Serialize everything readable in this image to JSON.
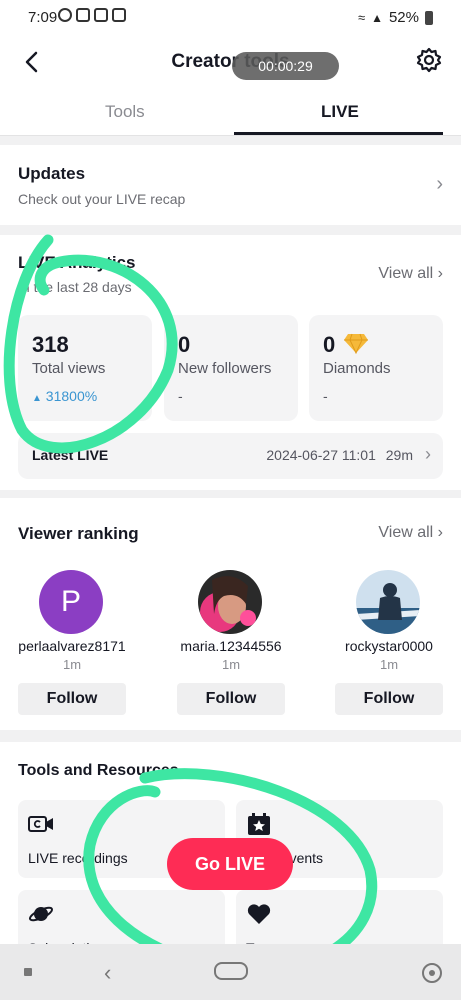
{
  "status_bar": {
    "time": "7:09",
    "battery": "52%"
  },
  "header": {
    "title": "Creator tools",
    "recording_timer": "00:00:29"
  },
  "tabs": [
    {
      "label": "Tools"
    },
    {
      "label": "LIVE",
      "active": true
    }
  ],
  "updates": {
    "title": "Updates",
    "subtitle": "Check out your LIVE recap"
  },
  "analytics": {
    "title": "LIVE Analytics",
    "subtitle": "In the last 28 days",
    "view_all": "View all",
    "stats": [
      {
        "value": "318",
        "label": "Total views",
        "change": "31800%"
      },
      {
        "value": "0",
        "label": "New followers",
        "change": "-"
      },
      {
        "value": "0",
        "label": "Diamonds",
        "change": "-"
      }
    ],
    "latest": {
      "label": "Latest LIVE",
      "date": "2024-06-27 11:01",
      "duration": "29m"
    }
  },
  "ranking": {
    "title": "Viewer ranking",
    "view_all": "View all",
    "viewers": [
      {
        "initial": "P",
        "name": "perlaalvarez8171",
        "time": "1m",
        "action": "Follow"
      },
      {
        "name": "maria.12344556",
        "time": "1m",
        "action": "Follow"
      },
      {
        "name": "rockystar0000",
        "time": "1m",
        "action": "Follow"
      }
    ]
  },
  "tools": {
    "title": "Tools and Resources",
    "items": [
      {
        "label": "LIVE recordings",
        "icon": "video-replay-icon"
      },
      {
        "label": "LIVE Events",
        "icon": "calendar-star-icon"
      },
      {
        "label": "Subscription",
        "icon": "planet-icon"
      },
      {
        "label": "Top",
        "icon": "heart-icon"
      }
    ]
  },
  "go_live": {
    "label": "Go LIVE"
  },
  "colors": {
    "accent": "#fe2c55",
    "positive_change": "#3a95d1",
    "annotation_marker": "#3ee6a3",
    "diamond": "#f5b93a"
  }
}
